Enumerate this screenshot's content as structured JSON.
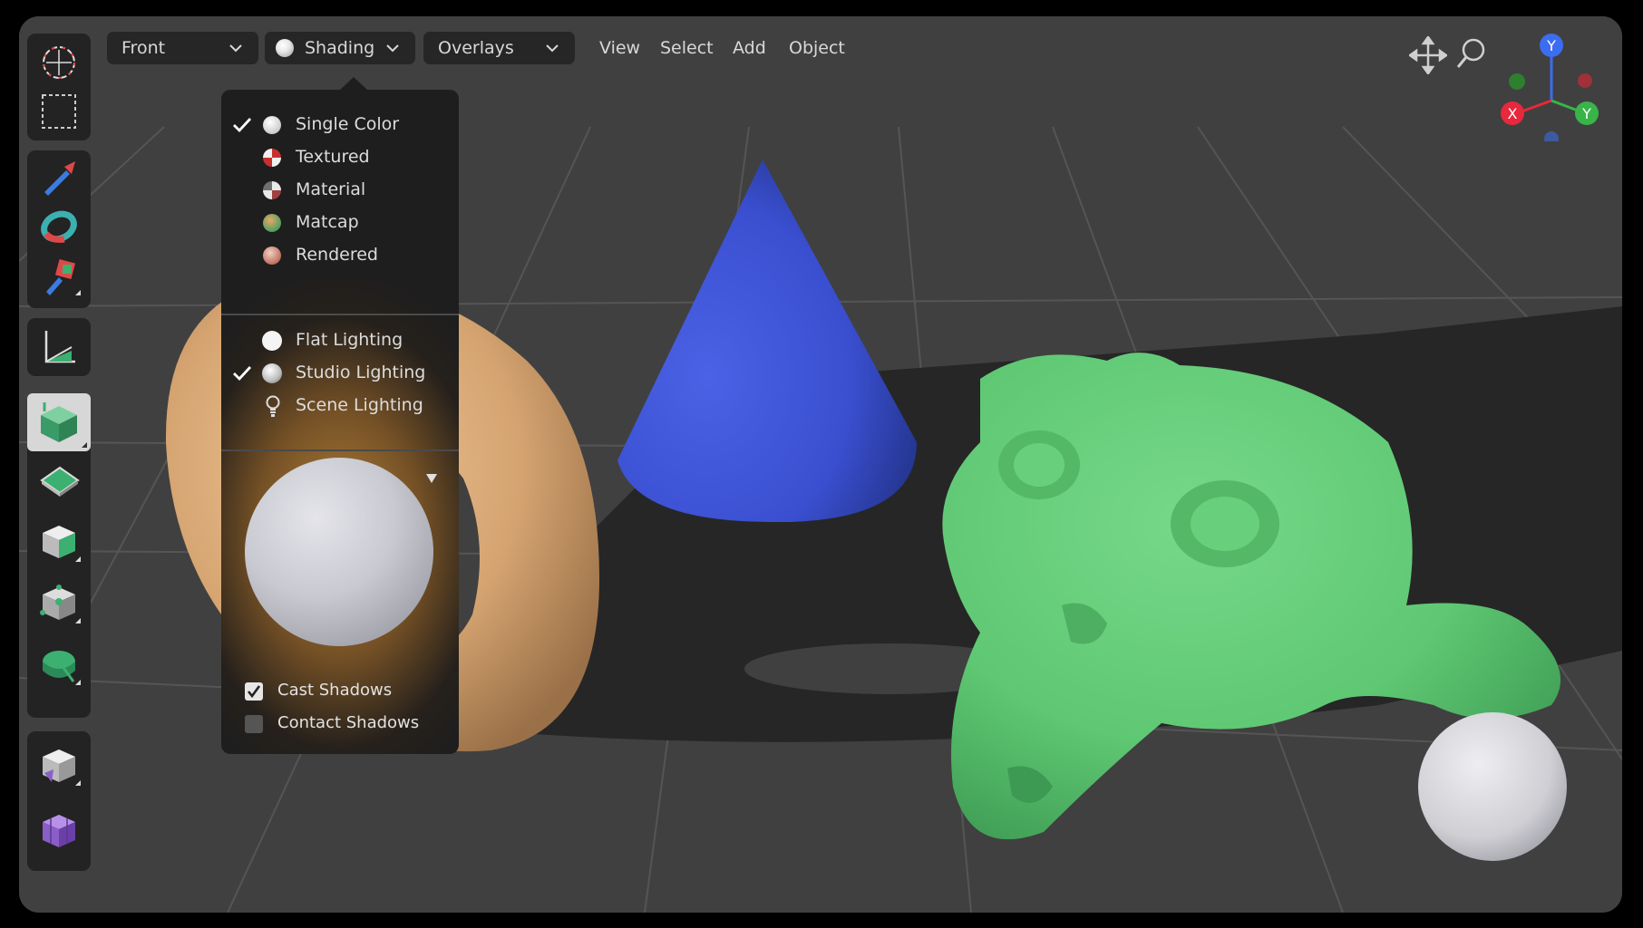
{
  "header": {
    "view_dropdown": "Front",
    "shading_dropdown": "Shading",
    "overlays_dropdown": "Overlays",
    "menus": [
      "View",
      "Select",
      "Add",
      "Object"
    ]
  },
  "gizmo": {
    "y_label": "Y",
    "x_label": "X",
    "y2_label": "Y",
    "colors": {
      "x": "#e8283c",
      "y": "#3f9f3a",
      "z": "#3c6cf0",
      "green_axis": "#38b448"
    }
  },
  "shading_menu": {
    "color_modes": [
      {
        "label": "Single Color",
        "checked": true,
        "icon": "white-sphere-icon"
      },
      {
        "label": "Textured",
        "checked": false,
        "icon": "checker-sphere-icon"
      },
      {
        "label": "Material",
        "checked": false,
        "icon": "material-sphere-icon"
      },
      {
        "label": "Matcap",
        "checked": false,
        "icon": "matcap-sphere-icon"
      },
      {
        "label": "Rendered",
        "checked": false,
        "icon": "rendered-sphere-icon"
      }
    ],
    "lighting_modes": [
      {
        "label": "Flat Lighting",
        "checked": false,
        "icon": "flat-circle-icon"
      },
      {
        "label": "Studio Lighting",
        "checked": true,
        "icon": "studio-sphere-icon"
      },
      {
        "label": "Scene Lighting",
        "checked": false,
        "icon": "light-bulb-icon"
      }
    ],
    "options": [
      {
        "label": "Cast Shadows",
        "checked": true
      },
      {
        "label": "Contact Shadows",
        "checked": false
      }
    ]
  },
  "scene_colors": {
    "torus": "#d8a878",
    "cone": "#3d52d6",
    "monkey": "#5fc873",
    "sphere": "#cfcfd4"
  }
}
